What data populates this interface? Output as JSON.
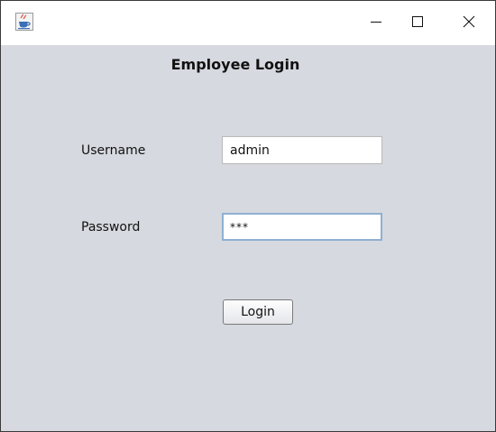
{
  "window": {
    "icon": "java-cup-icon",
    "controls": {
      "minimize": "minimize-icon",
      "maximize": "maximize-icon",
      "close": "close-icon"
    }
  },
  "form": {
    "heading": "Employee Login",
    "username_label": "Username",
    "username_value": "admin",
    "password_label": "Password",
    "password_masked": "***",
    "login_label": "Login"
  },
  "colors": {
    "background": "#d6d9df",
    "titlebar": "#ffffff",
    "focus_border": "#8fb0d2"
  }
}
